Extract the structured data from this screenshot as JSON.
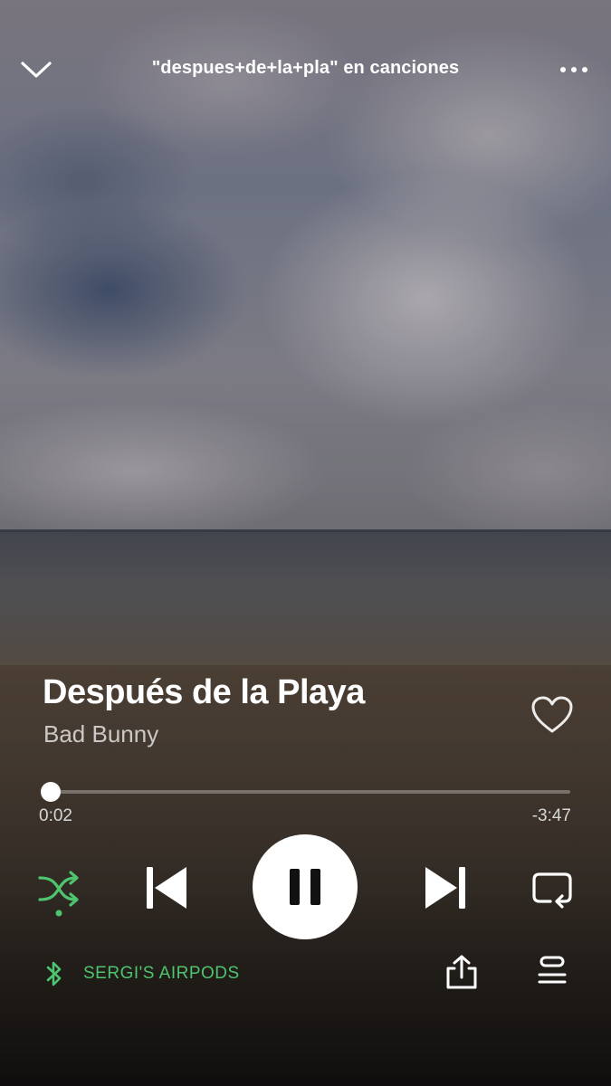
{
  "header": {
    "title": "\"despues+de+la+pla\" en canciones"
  },
  "track": {
    "title": "Después de la Playa",
    "artist": "Bad Bunny",
    "liked": false
  },
  "progress": {
    "elapsed": "0:02",
    "remaining": "-3:47",
    "fraction": 0.01
  },
  "controls": {
    "shuffle_active": true,
    "state": "playing"
  },
  "device": {
    "label": "SERGI'S AIRPODS"
  },
  "colors": {
    "accent_green": "#4ec46f",
    "text": "#ffffff"
  },
  "icons": [
    "chevron-down-icon",
    "more-icon",
    "heart-icon",
    "shuffle-icon",
    "previous-icon",
    "pause-icon",
    "next-icon",
    "repeat-icon",
    "bluetooth-icon",
    "share-icon",
    "queue-icon"
  ]
}
